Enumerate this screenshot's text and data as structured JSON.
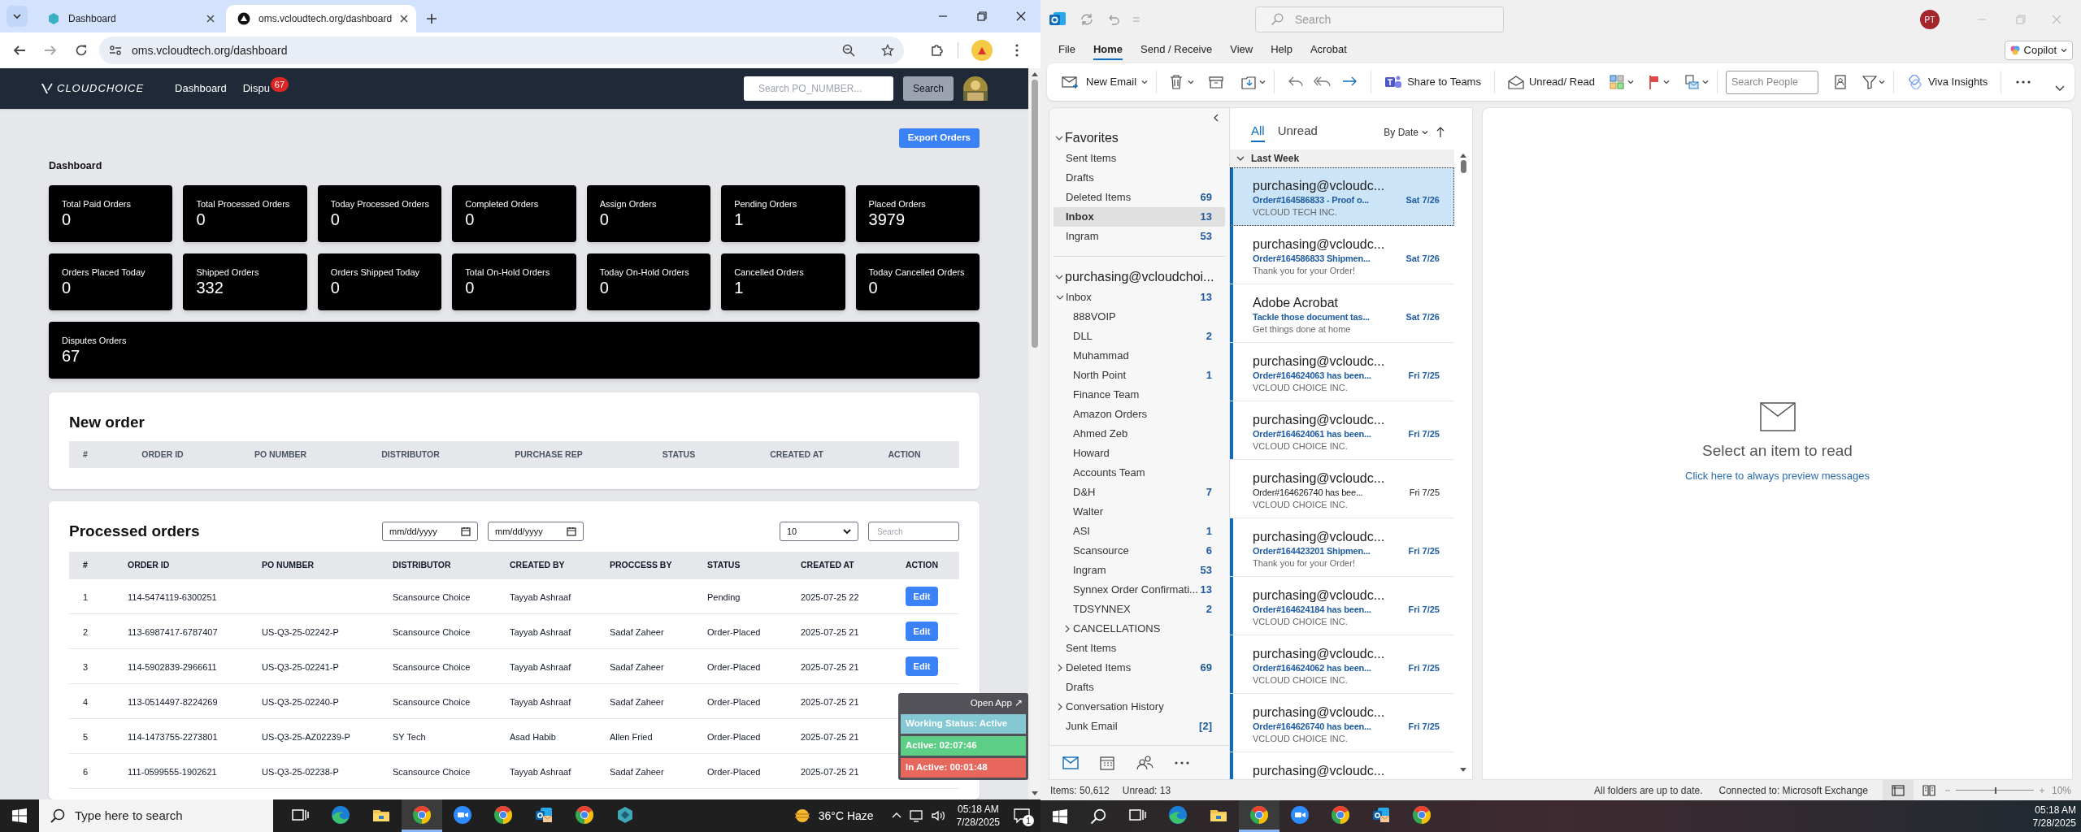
{
  "browser": {
    "tabs": [
      {
        "title": "Dashboard",
        "selected": false
      },
      {
        "title": "oms.vcloudtech.org/dashboard",
        "selected": true
      }
    ],
    "url": "oms.vcloudtech.org/dashboard"
  },
  "app": {
    "logo": "CLOUDCHOICE",
    "nav": [
      {
        "label": "Dashboard"
      },
      {
        "label": "Dispu",
        "badge": "67"
      }
    ],
    "search_placeholder": "Search PO_NUMBER...",
    "search_button": "Search",
    "export_button": "Export Orders",
    "section_title": "Dashboard",
    "stats": [
      {
        "label": "Total Paid Orders",
        "value": "0",
        "kind": "tile"
      },
      {
        "label": "Total Processed Orders",
        "value": "0",
        "kind": "tile"
      },
      {
        "label": "Today Processed Orders",
        "value": "0",
        "kind": "tile"
      },
      {
        "label": "Completed Orders",
        "value": "0",
        "kind": "tile"
      },
      {
        "label": "Assign Orders",
        "value": "0",
        "kind": "tile"
      },
      {
        "label": "Pending Orders",
        "value": "1",
        "kind": "tile"
      },
      {
        "label": "Placed Orders",
        "value": "3979",
        "kind": "tile"
      },
      {
        "label": "Orders Placed Today",
        "value": "0",
        "kind": "tile"
      },
      {
        "label": "Shipped Orders",
        "value": "332",
        "kind": "tile"
      },
      {
        "label": "Orders Shipped Today",
        "value": "0",
        "kind": "tile"
      },
      {
        "label": "Total On-Hold Orders",
        "value": "0",
        "kind": "tile"
      },
      {
        "label": "Today On-Hold Orders",
        "value": "0",
        "kind": "tile"
      },
      {
        "label": "Cancelled Orders",
        "value": "1",
        "kind": "tile"
      },
      {
        "label": "Today Cancelled Orders",
        "value": "0",
        "kind": "tile"
      },
      {
        "label": "Disputes Orders",
        "value": "67",
        "kind": "wide"
      }
    ],
    "new_order": {
      "title": "New order",
      "columns": [
        "#",
        "ORDER ID",
        "PO NUMBER",
        "DISTRIBUTOR",
        "PURCHASE REP",
        "STATUS",
        "CREATED AT",
        "ACTION"
      ]
    },
    "processed": {
      "title": "Processed orders",
      "date_from": "mm/dd/yyyy",
      "date_to": "mm/dd/yyyy",
      "page_size": "10",
      "search_placeholder": "Search",
      "columns": [
        "#",
        "ORDER ID",
        "PO NUMBER",
        "DISTRIBUTOR",
        "CREATED BY",
        "PROCCESS BY",
        "STATUS",
        "CREATED AT",
        "ACTION"
      ],
      "rows": [
        {
          "num": "1",
          "order_id": "114-5474119-6300251",
          "distributor": "Scansource Choice",
          "created_by": "Tayyab Ashraaf",
          "status": "Pending",
          "created_at": "2025-07-25 22",
          "action": "Edit"
        },
        {
          "num": "2",
          "order_id": "113-6987417-6787407",
          "po_number": "US-Q3-25-02242-P",
          "distributor": "Scansource Choice",
          "created_by": "Tayyab Ashraaf",
          "process_by": "Sadaf Zaheer",
          "status": "Order-Placed",
          "created_at": "2025-07-25 21",
          "action": "Edit"
        },
        {
          "num": "3",
          "order_id": "114-5902839-2966611",
          "po_number": "US-Q3-25-02241-P",
          "distributor": "Scansource Choice",
          "created_by": "Tayyab Ashraaf",
          "process_by": "Sadaf Zaheer",
          "status": "Order-Placed",
          "created_at": "2025-07-25 21",
          "action": "Edit"
        },
        {
          "num": "4",
          "order_id": "113-0514497-8224269",
          "po_number": "US-Q3-25-02240-P",
          "distributor": "Scansource Choice",
          "created_by": "Tayyab Ashraaf",
          "process_by": "Sadaf Zaheer",
          "status": "Order-Placed",
          "created_at": "2025-07-25 21"
        },
        {
          "num": "5",
          "order_id": "114-1473755-2273801",
          "po_number": "US-Q3-25-AZ02239-P",
          "distributor": "SY Tech",
          "created_by": "Asad Habib",
          "process_by": "Allen Fried",
          "status": "Order-Placed",
          "created_at": "2025-07-25 21"
        },
        {
          "num": "6",
          "order_id": "111-0599555-1902621",
          "po_number": "US-Q3-25-02238-P",
          "distributor": "Scansource Choice",
          "created_by": "Tayyab Ashraaf",
          "process_by": "Sadaf Zaheer",
          "status": "Order-Placed",
          "created_at": "2025-07-25 21"
        }
      ]
    }
  },
  "work_widget": {
    "open_app": "Open App ↗",
    "status": "Working Status: Active",
    "active": "Active: 02:07:46",
    "inactive": "In Active: 00:01:48"
  },
  "taskbar_left": {
    "search_placeholder": "Type here to search",
    "apps": [
      {
        "selected": false
      },
      {
        "selected": false
      },
      {
        "selected": false
      },
      {
        "selected": true
      },
      {
        "selected": false
      },
      {
        "selected": false
      },
      {
        "selected": false
      },
      {
        "selected": false
      },
      {
        "selected": false
      }
    ],
    "weather": "36°C Haze",
    "time": "05:18 AM",
    "date": "7/28/2025",
    "notifications": "1"
  },
  "outlook": {
    "search_placeholder": "Search",
    "avatar": "PT",
    "menu": [
      {
        "label": "File",
        "selected": false
      },
      {
        "label": "Home",
        "selected": true
      },
      {
        "label": "Send / Receive",
        "selected": false
      },
      {
        "label": "View",
        "selected": false
      },
      {
        "label": "Help",
        "selected": false
      },
      {
        "label": "Acrobat",
        "selected": false
      }
    ],
    "copilot": "Copilot",
    "ribbon": {
      "new_email": "New Email",
      "share_teams": "Share to Teams",
      "unread_read": "Unread/ Read",
      "search_people_placeholder": "Search People",
      "viva": "Viva Insights"
    },
    "folders": {
      "favorites": {
        "title": "Favorites",
        "expanded": true,
        "items": [
          {
            "name": "Sent Items",
            "selected": false
          },
          {
            "name": "Drafts",
            "selected": false
          },
          {
            "name": "Deleted Items",
            "count": "69",
            "selected": false
          },
          {
            "name": "Inbox",
            "count": "13",
            "selected": true
          },
          {
            "name": "Ingram",
            "count": "53",
            "selected": false
          }
        ]
      },
      "account": {
        "title": "purchasing@vcloudchoi...",
        "expanded": true,
        "children": [
          {
            "name": "Inbox",
            "count": "13",
            "expanded": true,
            "children": [
              {
                "name": "888VOIP"
              },
              {
                "name": "DLL",
                "count": "2"
              },
              {
                "name": "Muhammad"
              },
              {
                "name": "North Point",
                "count": "1"
              },
              {
                "name": "Finance Team"
              },
              {
                "name": "Amazon Orders"
              },
              {
                "name": "Ahmed Zeb"
              },
              {
                "name": "Howard"
              },
              {
                "name": "Accounts Team"
              },
              {
                "name": "D&H",
                "count": "7"
              },
              {
                "name": "Walter"
              },
              {
                "name": "ASI",
                "count": "1"
              },
              {
                "name": "Scansource",
                "count": "6"
              },
              {
                "name": "Ingram",
                "count": "53"
              },
              {
                "name": "Synnex Order Confirmati...",
                "count": "13"
              },
              {
                "name": "TDSYNNEX",
                "count": "2"
              },
              {
                "name": "CANCELLATIONS",
                "expanded": false
              }
            ]
          },
          {
            "name": "Sent Items"
          },
          {
            "name": "Deleted Items",
            "count": "69",
            "expanded": false
          },
          {
            "name": "Drafts"
          },
          {
            "name": "Conversation History",
            "expanded": false
          },
          {
            "name": "Junk Email",
            "count": "[2]"
          }
        ]
      }
    },
    "list": {
      "filters": [
        {
          "label": "All",
          "selected": true
        },
        {
          "label": "Unread",
          "selected": false
        }
      ],
      "sort": "By Date",
      "group": "Last Week",
      "messages": [
        {
          "sender": "purchasing@vcloudc...",
          "subject": "Order#164586833 - Proof o...",
          "preview": "VCLOUD TECH INC.",
          "date": "Sat 7/26",
          "unread": true,
          "selected": true
        },
        {
          "sender": "purchasing@vcloudc...",
          "subject": "Order#164586833 Shipmen...",
          "preview": "Thank you for your Order!",
          "date": "Sat 7/26",
          "unread": true,
          "selected": false
        },
        {
          "sender": "Adobe Acrobat",
          "subject": "Tackle those document tas...",
          "preview": "Get things done at home",
          "date": "Sat 7/26",
          "unread": true,
          "selected": false
        },
        {
          "sender": "purchasing@vcloudc...",
          "subject": "Order#164624063 has been...",
          "preview": "VCLOUD CHOICE INC.",
          "date": "Fri 7/25",
          "unread": true,
          "selected": false
        },
        {
          "sender": "purchasing@vcloudc...",
          "subject": "Order#164624061 has been...",
          "preview": "VCLOUD CHOICE INC.",
          "date": "Fri 7/25",
          "unread": true,
          "selected": false
        },
        {
          "sender": "purchasing@vcloudc...",
          "subject": "Order#164626740 has bee...",
          "preview": "VCLOUD CHOICE INC.",
          "date": "Fri 7/25",
          "unread": false,
          "selected": false
        },
        {
          "sender": "purchasing@vcloudc...",
          "subject": "Order#164423201 Shipmen...",
          "preview": "Thank you for your Order!",
          "date": "Fri 7/25",
          "unread": true,
          "selected": false
        },
        {
          "sender": "purchasing@vcloudc...",
          "subject": "Order#164624184 has been...",
          "preview": "VCLOUD CHOICE INC.",
          "date": "Fri 7/25",
          "unread": true,
          "selected": false
        },
        {
          "sender": "purchasing@vcloudc...",
          "subject": "Order#164624062 has been...",
          "preview": "VCLOUD CHOICE INC.",
          "date": "Fri 7/25",
          "unread": true,
          "selected": false
        },
        {
          "sender": "purchasing@vcloudc...",
          "subject": "Order#164626740 has been...",
          "preview": "VCLOUD CHOICE INC.",
          "date": "Fri 7/25",
          "unread": true,
          "selected": false
        },
        {
          "sender": "purchasing@vcloudc...",
          "unread": true,
          "selected": false
        }
      ]
    },
    "reading": {
      "title": "Select an item to read",
      "link": "Click here to always preview messages"
    },
    "status": {
      "items": "Items: 50,612",
      "unread": "Unread: 13",
      "sync": "All folders are up to date.",
      "connection": "Connected to: Microsoft Exchange",
      "zoom_slider": {
        "level": 0.5
      },
      "zoom": "10%"
    }
  },
  "taskbar_right": {
    "apps": [
      {
        "selected": false
      },
      {
        "selected": false
      },
      {
        "selected": false
      },
      {
        "selected": true
      },
      {
        "selected": false
      },
      {
        "selected": false
      },
      {
        "selected": false
      },
      {
        "selected": false
      }
    ],
    "time": "05:18 AM",
    "date": "7/28/2025"
  }
}
